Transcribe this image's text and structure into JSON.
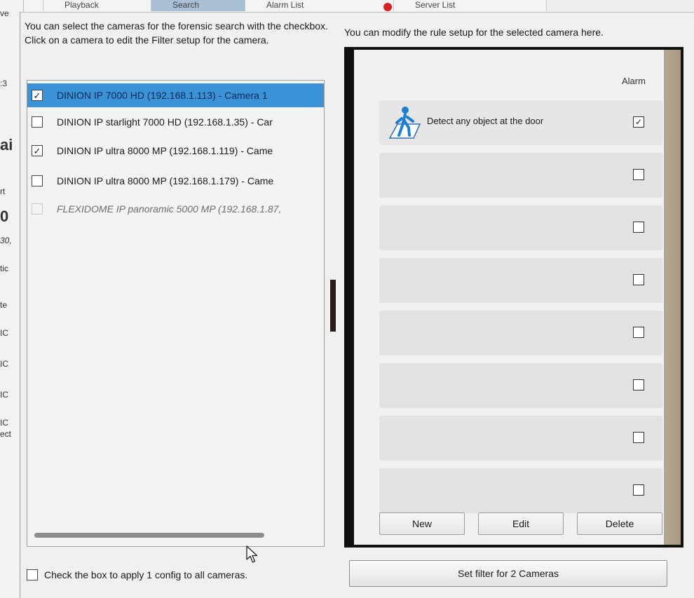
{
  "background": {
    "tabs": [
      {
        "label": "Playback"
      },
      {
        "label": "Search"
      },
      {
        "label": "Alarm List"
      },
      {
        "label": "Server List"
      }
    ],
    "left_fragments": [
      "ve",
      ":3",
      "ai",
      "rt",
      "0",
      "30,",
      "tic",
      "te",
      "IC",
      "IC",
      "IC",
      "IC",
      "ect"
    ]
  },
  "dialog": {
    "left_instructions": "You can select the cameras for the forensic search with the checkbox. Click on a camera to edit the Filter setup for the camera.",
    "right_instructions": "You can modify the rule setup for the selected camera here.",
    "cameras": [
      {
        "label": "DINION IP 7000 HD (192.168.1.113) - Camera 1",
        "checked": true,
        "selected": true,
        "enabled": true
      },
      {
        "label": "DINION IP starlight 7000 HD (192.168.1.35) - Car",
        "checked": false,
        "selected": false,
        "enabled": true
      },
      {
        "label": "DINION IP ultra 8000 MP (192.168.1.119) - Came",
        "checked": true,
        "selected": false,
        "enabled": true
      },
      {
        "label": "DINION IP ultra 8000 MP (192.168.1.179) - Came",
        "checked": false,
        "selected": false,
        "enabled": true
      },
      {
        "label": "FLEXIDOME IP panoramic 5000 MP (192.168.1.87,",
        "checked": false,
        "selected": false,
        "enabled": false
      }
    ],
    "apply_all_label": "Check the box to apply 1 config to all cameras.",
    "apply_all_checked": false,
    "rule_editor": {
      "alarm_header": "Alarm",
      "rules": [
        {
          "name": "Detect any object at the door",
          "alarm": true,
          "icon": "person-in-area-icon"
        },
        {
          "name": "",
          "alarm": false
        },
        {
          "name": "",
          "alarm": false
        },
        {
          "name": "",
          "alarm": false
        },
        {
          "name": "",
          "alarm": false
        },
        {
          "name": "",
          "alarm": false
        },
        {
          "name": "",
          "alarm": false
        },
        {
          "name": "",
          "alarm": false
        }
      ],
      "buttons": {
        "new": "New",
        "edit": "Edit",
        "delete": "Delete"
      }
    },
    "set_filter_label": "Set filter for 2 Cameras"
  },
  "colors": {
    "selection": "#3b92d6",
    "dialog_bg": "#f0f0f0",
    "panel_border": "#9c9c9c",
    "rule_row": "#e2e2e2"
  }
}
